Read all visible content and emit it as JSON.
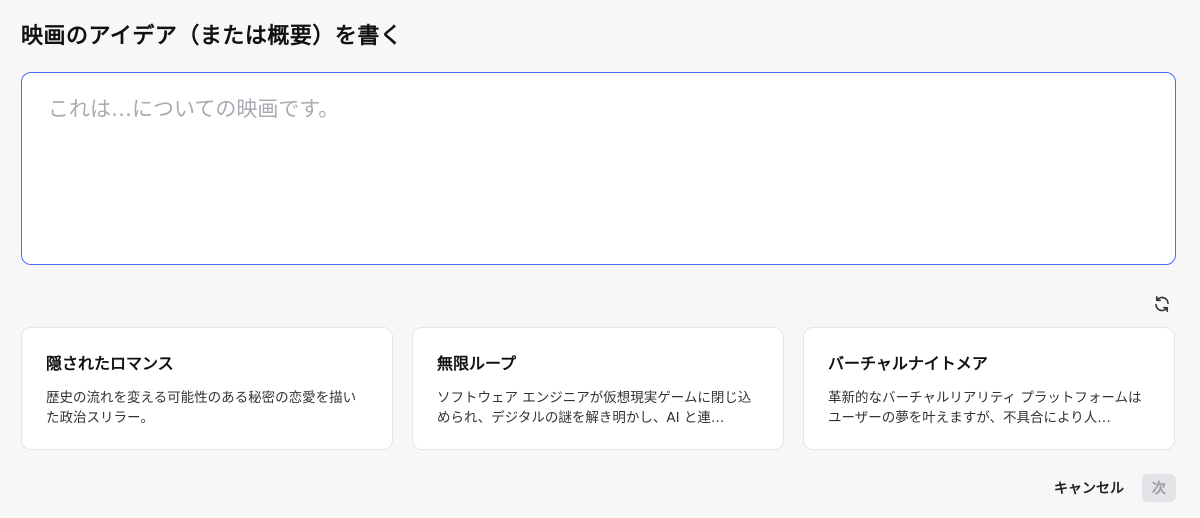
{
  "header": {
    "title": "映画のアイデア（または概要）を書く"
  },
  "idea_input": {
    "value": "",
    "placeholder": "これは…についての映画です。"
  },
  "refresh": {
    "icon": "refresh-icon"
  },
  "suggestions": [
    {
      "title": "隠されたロマンス",
      "description": "歴史の流れを変える可能性のある秘密の恋愛を描いた政治スリラー。"
    },
    {
      "title": "無限ループ",
      "description": "ソフトウェア エンジニアが仮想現実ゲームに閉じ込められ、デジタルの謎を解き明かし、AI と連…"
    },
    {
      "title": "バーチャルナイトメア",
      "description": "革新的なバーチャルリアリティ プラットフォームはユーザーの夢を叶えますが、不具合により人…"
    }
  ],
  "footer": {
    "cancel_label": "キャンセル",
    "next_label": "次"
  },
  "colors": {
    "accent_border": "#4a6cf7",
    "disabled_bg": "#e3e4e8",
    "disabled_text": "#9a9ca3"
  }
}
